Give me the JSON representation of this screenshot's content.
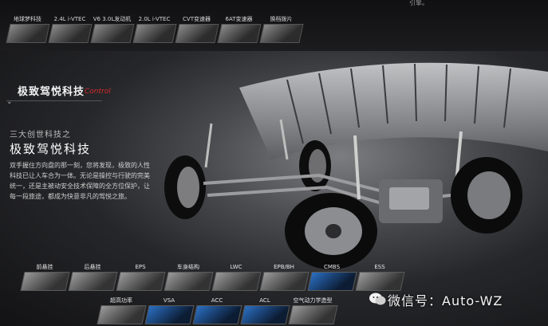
{
  "top_features": [
    "地球梦科技",
    "2.4L i-VTEC",
    "V6 3.0L发动机",
    "2.0L i-VTEC",
    "CVT变速器",
    "6AT变速器",
    "换档拨片"
  ],
  "corner_text": "引擎。",
  "section": {
    "title": "极致驾悦科技",
    "title_en": "Control"
  },
  "hero": {
    "kicker": "三大创世科技之",
    "title": "极致驾悦科技",
    "description": "双手握住方向盘的那一刻，您将发现，极致的人性科技已让人车合为一体。无论是操控与行驶的完美统一，还是主被动安全技术保障的全方位保护，让每一段旅途，都成为快意非凡的驾悦之旅。"
  },
  "bottom_row1": [
    "前悬挂",
    "后悬挂",
    "EPS",
    "车身结构",
    "LWC",
    "EPB/BH",
    "CMBS",
    "ESS"
  ],
  "bottom_row2": [
    "超高功率",
    "VSA",
    "ACC",
    "ACL",
    "空气动力学造型"
  ],
  "watermark": "微信号：Auto-WZ",
  "colors": {
    "accent_red": "#d42b2b",
    "background": "#141416"
  }
}
